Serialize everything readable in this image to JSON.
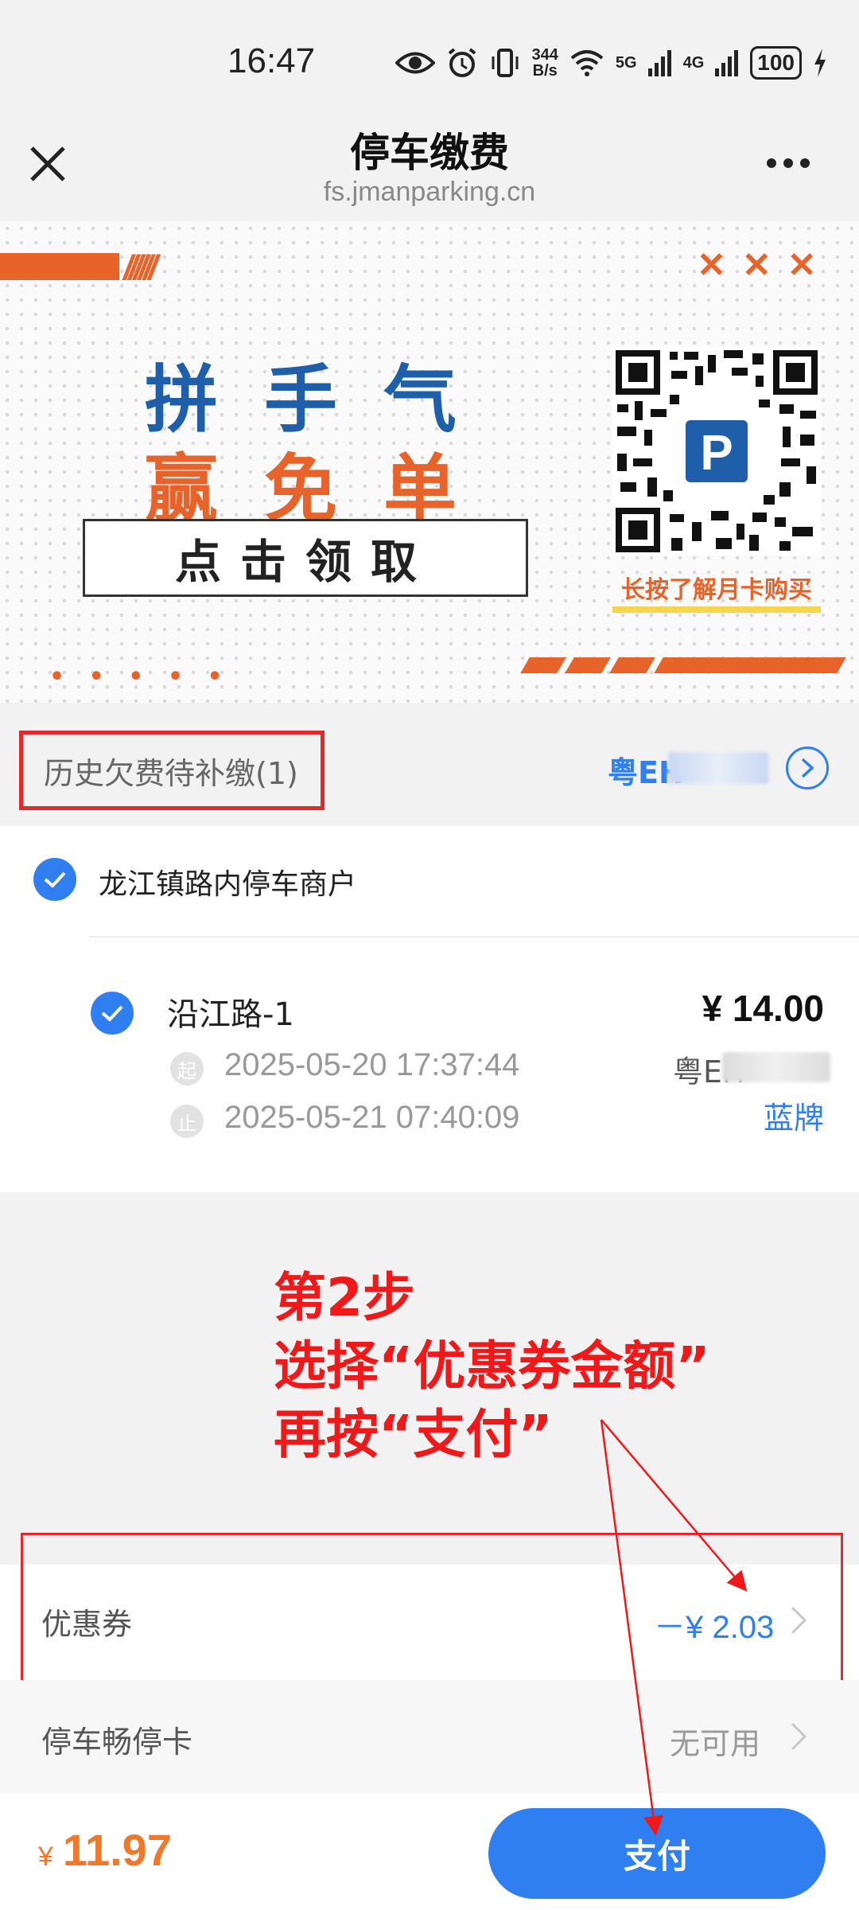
{
  "status_bar": {
    "time": "16:47",
    "net_speed": "344",
    "net_unit": "B/s",
    "sig1": "5G",
    "sig2": "4G",
    "battery": "100"
  },
  "title_bar": {
    "title": "停车缴费",
    "url": "fs.jmanparking.cn"
  },
  "banner": {
    "slogan_line1": "拼手气",
    "slogan_line2": "赢免单",
    "claim_button": "点击领取",
    "qr_caption": "长按了解月卡购买",
    "qr_logo": "P",
    "xmarks": "✕✕✕",
    "slashes": "//////",
    "dots": "• • • • •",
    "colors": {
      "orange": "#e8632a",
      "blue": "#1f5ea8"
    }
  },
  "history": {
    "label": "历史欠费待补缴(1)",
    "plate": "粤EH"
  },
  "merchant": {
    "name": "龙江镇路内停车商户",
    "items": [
      {
        "name": "沿江路-1",
        "start_tag": "起",
        "start": "2025-05-20 17:37:44",
        "end_tag": "止",
        "end": "2025-05-21 07:40:09",
        "amount": "¥ 14.00",
        "plate": "粤EH",
        "plate_color": "蓝牌"
      }
    ]
  },
  "annotation": {
    "line1": "第2步",
    "line2": "选择“优惠券金额”",
    "line3": "再按“支付”"
  },
  "coupon": {
    "label": "优惠券",
    "value": "－¥ 2.03"
  },
  "parking_card": {
    "label": "停车畅停卡",
    "value": "无可用"
  },
  "footer": {
    "currency": "¥",
    "total": "11.97",
    "pay_label": "支付"
  }
}
